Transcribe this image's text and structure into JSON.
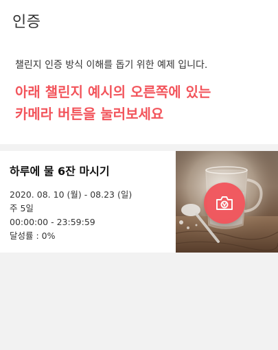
{
  "header": {
    "title": "인증"
  },
  "intro": {
    "description": "챌린지 인증 방식 이해를 돕기 위한 예제 입니다.",
    "hint_line1": "아래 챌린지 예시의 오른쪽에 있는",
    "hint_line2": "카메라 버튼을 눌러보세요"
  },
  "challenge": {
    "title": "하루에 물 6잔 마시기",
    "period": "2020. 08. 10 (월) - 08.23 (일)",
    "frequency": "주 5일",
    "time": "00:00:00 - 23:59:59",
    "achievement": "달성률 : 0%",
    "camera_icon": "camera-icon",
    "accent_color": "#f2545b"
  }
}
